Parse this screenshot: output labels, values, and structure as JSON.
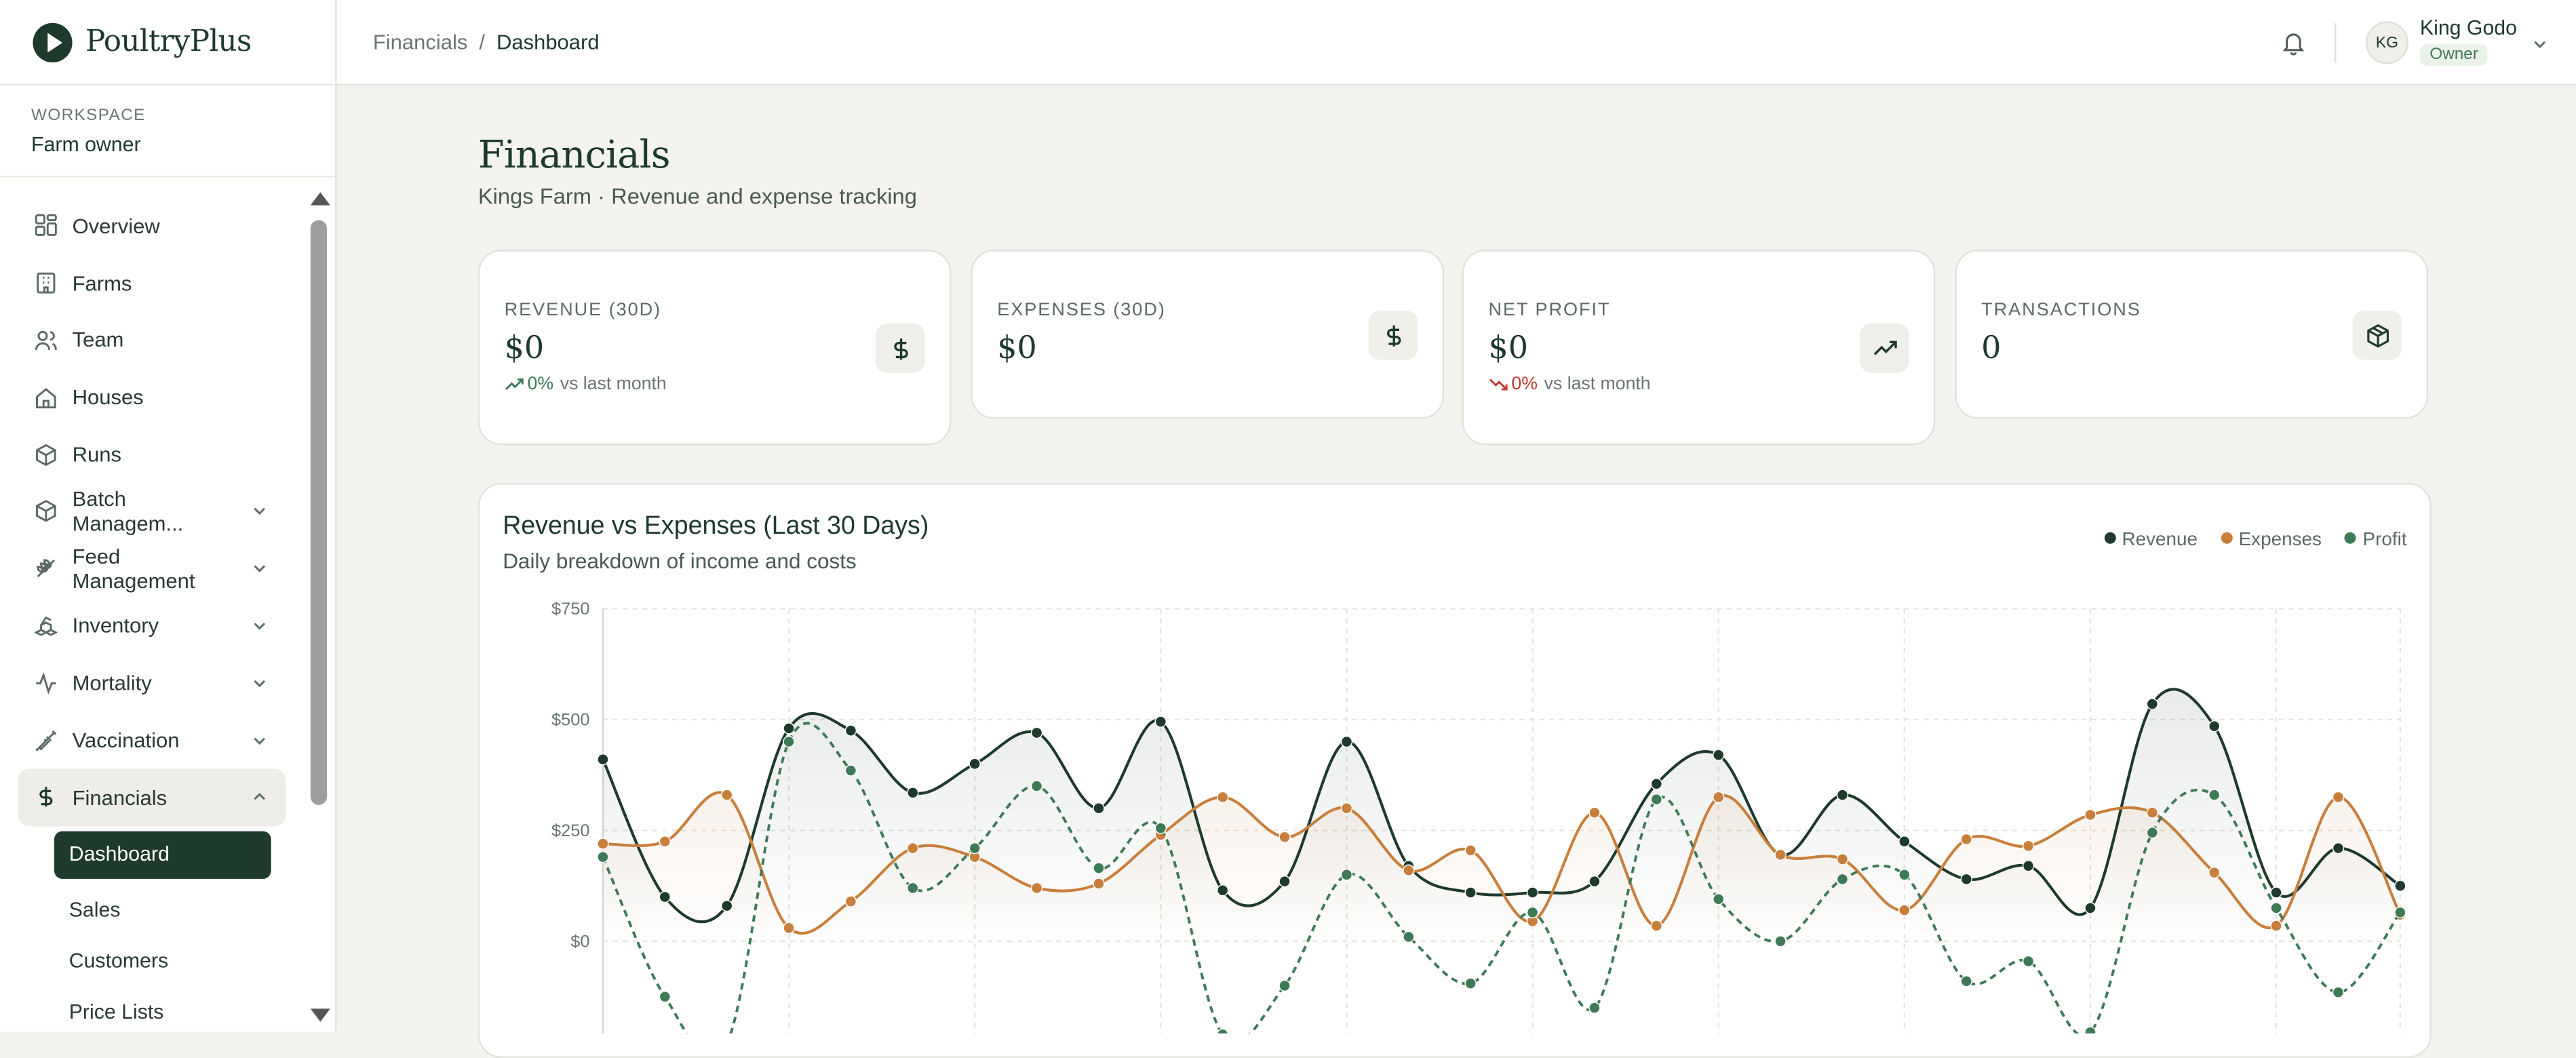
{
  "brand": {
    "name": "PoultryPlus"
  },
  "workspace": {
    "label": "WORKSPACE",
    "name": "Farm owner"
  },
  "sidebar": {
    "items": [
      {
        "label": "Overview",
        "icon": "grid-icon"
      },
      {
        "label": "Farms",
        "icon": "building-icon"
      },
      {
        "label": "Team",
        "icon": "users-icon"
      },
      {
        "label": "Houses",
        "icon": "house-icon"
      },
      {
        "label": "Runs",
        "icon": "box-icon"
      },
      {
        "label": "Batch Managem...",
        "icon": "box-icon",
        "expandable": true
      },
      {
        "label": "Feed Management",
        "icon": "wheat-icon",
        "expandable": true
      },
      {
        "label": "Inventory",
        "icon": "boxes-icon",
        "expandable": true
      },
      {
        "label": "Mortality",
        "icon": "activity-icon",
        "expandable": true
      },
      {
        "label": "Vaccination",
        "icon": "syringe-icon",
        "expandable": true
      },
      {
        "label": "Financials",
        "icon": "dollar-icon",
        "expandable": true,
        "expanded": true
      }
    ],
    "financials_sub": [
      {
        "label": "Dashboard",
        "current": true
      },
      {
        "label": "Sales"
      },
      {
        "label": "Customers"
      },
      {
        "label": "Price Lists"
      }
    ]
  },
  "header": {
    "breadcrumb": [
      "Financials",
      "Dashboard"
    ],
    "breadcrumb_sep": "/",
    "user": {
      "initials": "KG",
      "name": "King Godo",
      "role": "Owner"
    }
  },
  "page": {
    "title": "Financials",
    "subtitle": "Kings Farm · Revenue and expense tracking"
  },
  "cards": [
    {
      "label": "REVENUE (30D)",
      "value": "$0",
      "trend_pct": "0%",
      "trend_text": "vs last month",
      "trend_dir": "up",
      "icon": "dollar-icon"
    },
    {
      "label": "EXPENSES (30D)",
      "value": "$0",
      "icon": "dollar-icon"
    },
    {
      "label": "NET PROFIT",
      "value": "$0",
      "trend_pct": "0%",
      "trend_text": "vs last month",
      "trend_dir": "down",
      "icon": "trending-up-icon"
    },
    {
      "label": "TRANSACTIONS",
      "value": "0",
      "icon": "package-icon"
    }
  ],
  "colors": {
    "revenue": "#1d3a2c",
    "expenses": "#c87f3c",
    "profit": "#3e7a56",
    "trend_up": "#3e7a56",
    "trend_down": "#c0392b"
  },
  "chart_data": {
    "type": "line",
    "title": "Revenue vs Expenses (Last 30 Days)",
    "subtitle": "Daily breakdown of income and costs",
    "legend_position": "top-right",
    "grid": true,
    "y_ticks": [
      "$750",
      "$500",
      "$250",
      "$0"
    ],
    "ylim": [
      -250,
      750
    ],
    "series": [
      {
        "name": "Revenue",
        "style": "solid",
        "values": [
          410,
          100,
          80,
          480,
          475,
          335,
          400,
          470,
          300,
          495,
          115,
          135,
          450,
          170,
          110,
          110,
          135,
          355,
          420,
          195,
          330,
          225,
          140,
          170,
          75,
          535,
          485,
          110,
          210,
          125
        ]
      },
      {
        "name": "Expenses",
        "style": "solid",
        "values": [
          220,
          225,
          330,
          30,
          90,
          210,
          190,
          120,
          130,
          240,
          325,
          235,
          300,
          160,
          205,
          45,
          290,
          35,
          325,
          195,
          185,
          70,
          230,
          215,
          285,
          290,
          155,
          35,
          325,
          60
        ]
      },
      {
        "name": "Profit",
        "style": "dashed",
        "values": [
          190,
          -125,
          -230,
          450,
          385,
          120,
          210,
          350,
          165,
          255,
          -210,
          -100,
          150,
          10,
          -95,
          65,
          -150,
          320,
          95,
          0,
          140,
          150,
          -90,
          -45,
          -205,
          245,
          330,
          75,
          -115,
          65
        ]
      }
    ]
  }
}
